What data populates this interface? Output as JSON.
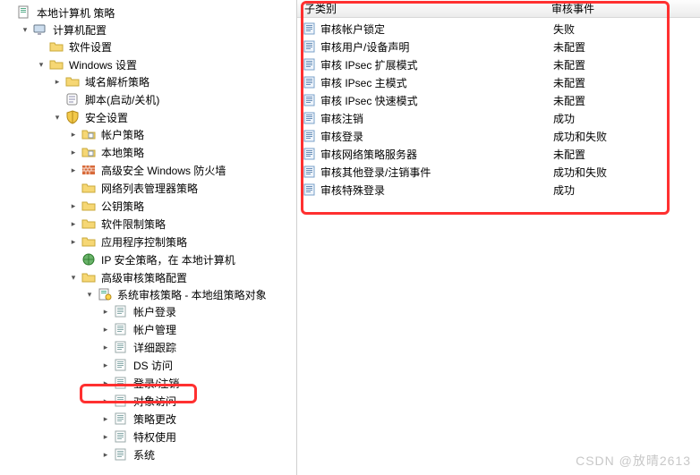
{
  "tree": {
    "root": "本地计算机 策略",
    "computer_config": "计算机配置",
    "software_settings": "软件设置",
    "windows_settings": "Windows 设置",
    "dns_policy": "域名解析策略",
    "scripts": "脚本(启动/关机)",
    "security_settings": "安全设置",
    "account_policy": "帐户策略",
    "local_policy": "本地策略",
    "advanced_firewall": "高级安全 Windows 防火墙",
    "network_list": "网络列表管理器策略",
    "public_key": "公钥策略",
    "software_restriction": "软件限制策略",
    "app_control": "应用程序控制策略",
    "ip_security": "IP 安全策略，在 本地计算机",
    "advanced_audit": "高级审核策略配置",
    "system_audit": "系统审核策略 - 本地组策略对象",
    "acct_logon": "帐户登录",
    "acct_mgmt": "帐户管理",
    "detailed_tracking": "详细跟踪",
    "ds_access": "DS 访问",
    "logon_logoff": "登录/注销",
    "object_access": "对象访问",
    "policy_change": "策略更改",
    "privilege_use": "特权使用",
    "system": "系统"
  },
  "columns": {
    "subcategory": "子类别",
    "audit_events": "审核事件"
  },
  "rows": [
    {
      "name": "审核帐户锁定",
      "value": "失败"
    },
    {
      "name": "审核用户/设备声明",
      "value": "未配置"
    },
    {
      "name": "审核 IPsec 扩展模式",
      "value": "未配置"
    },
    {
      "name": "审核 IPsec 主模式",
      "value": "未配置"
    },
    {
      "name": "审核 IPsec 快速模式",
      "value": "未配置"
    },
    {
      "name": "审核注销",
      "value": "成功"
    },
    {
      "name": "审核登录",
      "value": "成功和失败"
    },
    {
      "name": "审核网络策略服务器",
      "value": "未配置"
    },
    {
      "name": "审核其他登录/注销事件",
      "value": "成功和失败"
    },
    {
      "name": "审核特殊登录",
      "value": "成功"
    }
  ],
  "watermark": "CSDN @放晴2613"
}
